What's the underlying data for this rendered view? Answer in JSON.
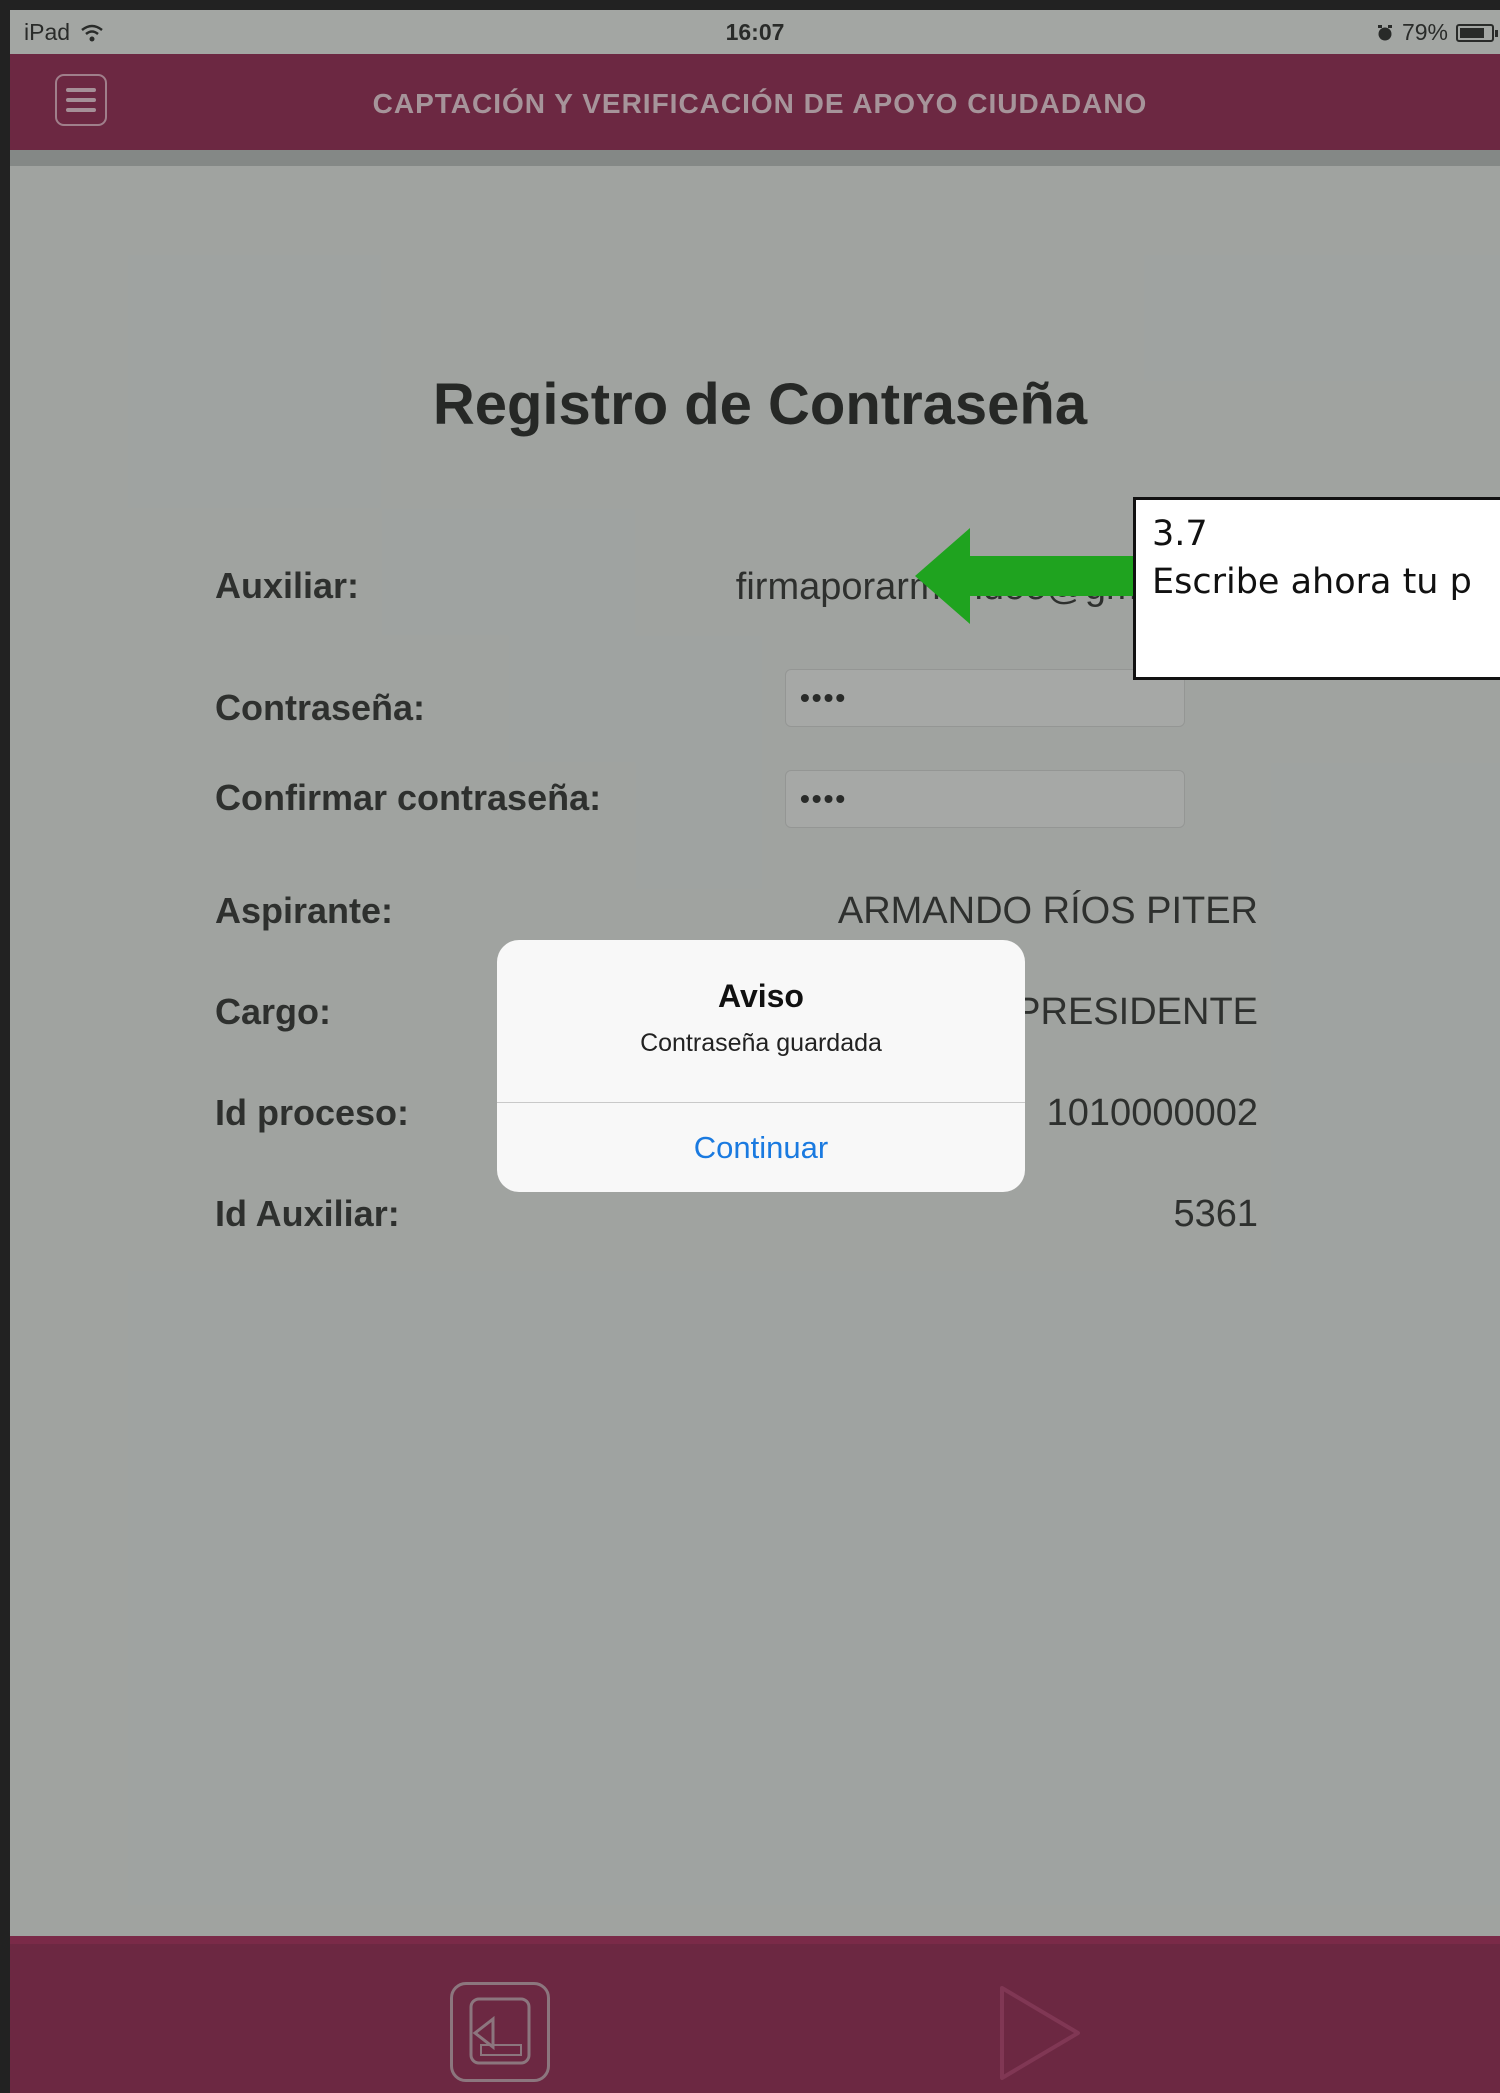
{
  "status_bar": {
    "device": "iPad",
    "time": "16:07",
    "battery": "79%",
    "battery_level_pct": 79
  },
  "header": {
    "title": "CAPTACIÓN Y VERIFICACIÓN DE APOYO CIUDADANO"
  },
  "form": {
    "title": "Registro de Contraseña",
    "auxiliar_label": "Auxiliar:",
    "auxiliar_value": "firmaporarmandoe@gmail.com",
    "password_label": "Contraseña:",
    "password_value": "••••",
    "confirm_label": "Confirmar contraseña:",
    "confirm_value": "••••",
    "aspirante_label": "Aspirante:",
    "aspirante_value": "ARMANDO RÍOS PITER",
    "cargo_label": "Cargo:",
    "cargo_value": "PRESIDENTE",
    "id_proceso_label": "Id proceso:",
    "id_proceso_value": "1010000002",
    "id_auxiliar_label": "Id Auxiliar:",
    "id_auxiliar_value": "5361"
  },
  "annotation": {
    "step": "3.7",
    "text": "Escribe ahora tu p"
  },
  "alert": {
    "title": "Aviso",
    "message": "Contraseña guardada",
    "button": "Continuar"
  },
  "colors": {
    "brand": "#8a0b3e",
    "link": "#1a7ae0",
    "arrow": "#1fa31f"
  }
}
